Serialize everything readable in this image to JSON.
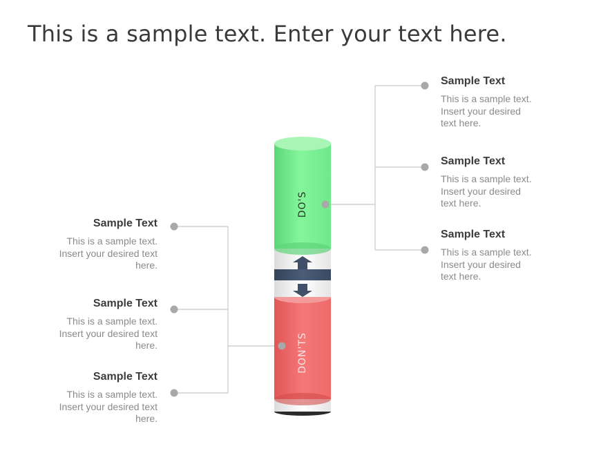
{
  "title": "This is a sample text. Enter your text here.",
  "cylinders": {
    "top": {
      "label": "DO'S",
      "color": "#7ef094",
      "text_color": "#1f3a24"
    },
    "bottom": {
      "label": "DON'TS",
      "color": "#f06c6c",
      "text_color": "#fbe3e3"
    },
    "connector_color": "#3f5068"
  },
  "connector_color": "#c8c8c8",
  "dot_color": "#a8a8a8",
  "right_items": [
    {
      "heading": "Sample Text",
      "body": "This is a sample text.\nInsert your desired\ntext here."
    },
    {
      "heading": "Sample Text",
      "body": "This is a sample text.\nInsert your desired\ntext here."
    },
    {
      "heading": "Sample Text",
      "body": "This is a sample text.\nInsert your desired\ntext here."
    }
  ],
  "left_items": [
    {
      "heading": "Sample Text",
      "body": "This is a sample text.\nInsert your desired text\nhere."
    },
    {
      "heading": "Sample Text",
      "body": "This is a sample text.\nInsert your desired text\nhere."
    },
    {
      "heading": "Sample Text",
      "body": "This is a sample text.\nInsert your desired text\nhere."
    }
  ]
}
